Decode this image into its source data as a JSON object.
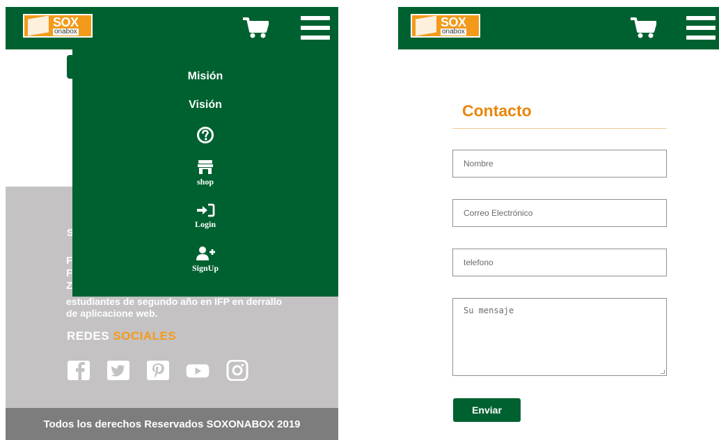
{
  "brand": {
    "logo_main": "SOX",
    "logo_sub": "onabox"
  },
  "colors": {
    "header_green": "#006130",
    "accent_orange": "#f39a1b",
    "footer_gray": "#c4c2c3",
    "bottom_bar_gray": "#7d7d7d"
  },
  "left_screen": {
    "header": {
      "cart_icon": "shopping-cart-icon",
      "menu_icon": "hamburger-menu-icon"
    },
    "dropdown_menu": {
      "items": [
        {
          "label": "Misión"
        },
        {
          "label": "Visión"
        },
        {
          "icon": "question-circle-icon"
        },
        {
          "icon": "store-icon",
          "label": "shop"
        },
        {
          "icon": "sign-in-icon",
          "label": "Login"
        },
        {
          "icon": "user-plus-icon",
          "label": "SignUp"
        }
      ]
    },
    "footer": {
      "about_heading_partial": "S",
      "about_text_lines": [
        {
          "lead": "F",
          "rest": ""
        },
        {
          "lead": "F",
          "rest": ""
        },
        {
          "lead": "Z",
          "rest": ""
        }
      ],
      "about_visible_text": "estudiantes de segundo año en IFP en derrallo de aplicacione web.",
      "social_title_part1": "REDES",
      "social_title_part2": "SOCIALES",
      "social_icons": [
        "facebook-icon",
        "twitter-icon",
        "pinterest-icon",
        "youtube-icon",
        "instagram-icon"
      ],
      "copyright": "Todos los derechos Reservados SOXONABOX 2019"
    }
  },
  "right_screen": {
    "header": {
      "cart_icon": "shopping-cart-icon",
      "menu_icon": "hamburger-menu-icon"
    },
    "contact_form": {
      "title": "Contacto",
      "name_placeholder": "Nombre",
      "email_placeholder": "Correo Electrónico",
      "phone_placeholder": "telefono",
      "message_placeholder": "Su mensaje",
      "submit_label": "Enviar"
    }
  }
}
